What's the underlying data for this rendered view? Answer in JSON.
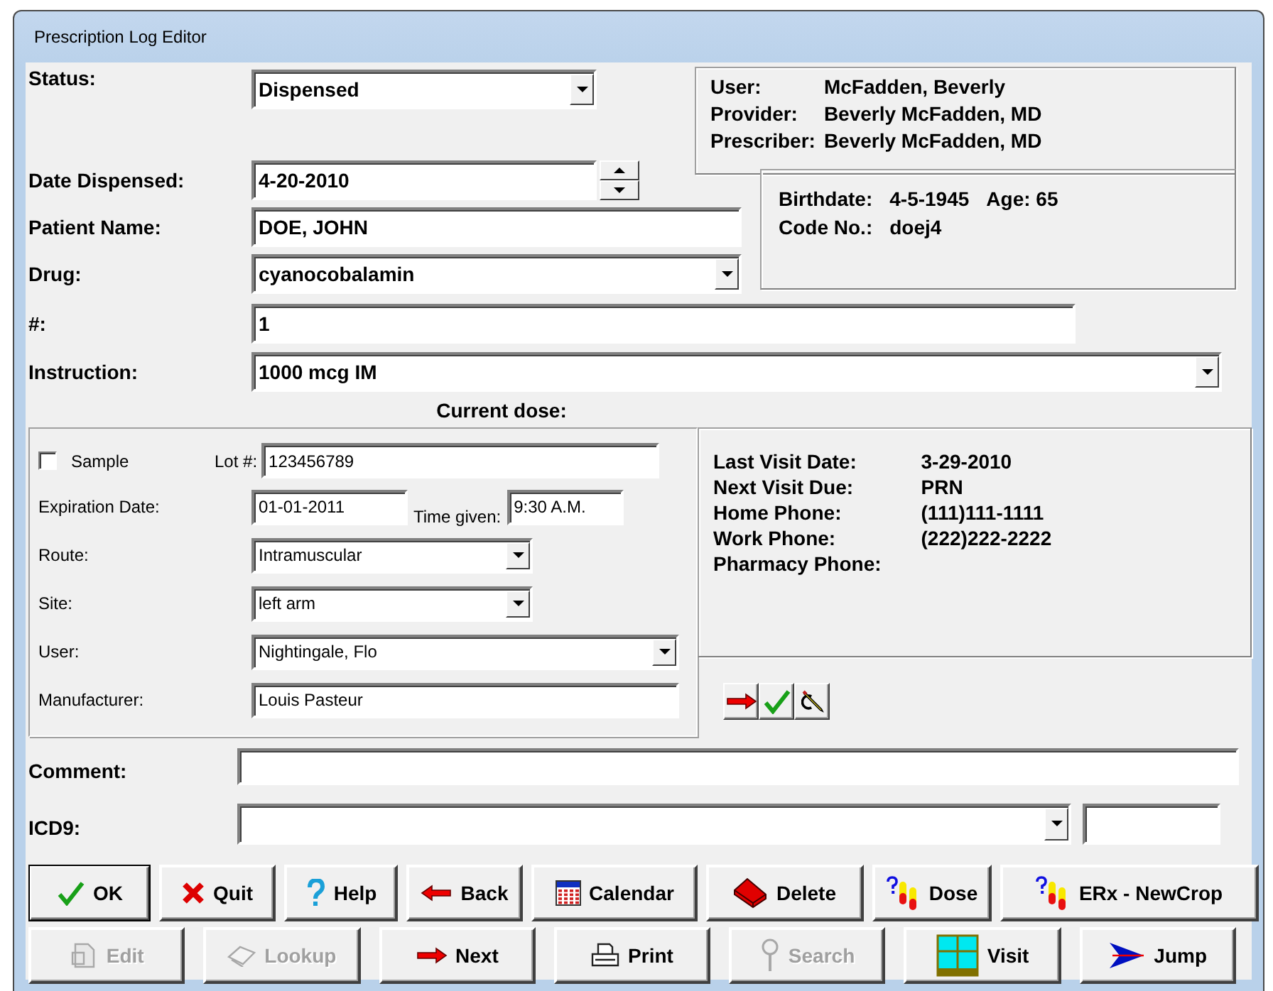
{
  "window": {
    "title": "Prescription Log Editor"
  },
  "status": {
    "label": "Status:",
    "value": "Dispensed"
  },
  "user_box": [
    {
      "label": "User:",
      "value": "McFadden, Beverly"
    },
    {
      "label": "Provider:",
      "value": "Beverly McFadden, MD"
    },
    {
      "label": "Prescriber:",
      "value": "Beverly McFadden, MD"
    }
  ],
  "date_dispensed": {
    "label": "Date Dispensed:",
    "value": "4-20-2010"
  },
  "patient_name": {
    "label": "Patient Name:",
    "value": "DOE, JOHN"
  },
  "patient_box": {
    "birthdate_label": "Birthdate:",
    "birthdate": "4-5-1945",
    "age": "Age: 65",
    "code_label": "Code No.:",
    "code": "doej4"
  },
  "drug": {
    "label": "Drug:",
    "value": "cyanocobalamin"
  },
  "quantity": {
    "label": "#:",
    "value": "1"
  },
  "instruction": {
    "label": "Instruction:",
    "value": "1000 mcg IM"
  },
  "current_dose": {
    "title": "Current dose:",
    "sample": {
      "label": "Sample",
      "checked": false
    },
    "lot": {
      "label": "Lot #:",
      "value": "123456789"
    },
    "expiration": {
      "label": "Expiration Date:",
      "value": "01-01-2011"
    },
    "time_given": {
      "label": "Time given:",
      "value": "9:30 A.M."
    },
    "route": {
      "label": "Route:",
      "value": "Intramuscular"
    },
    "site": {
      "label": "Site:",
      "value": "left arm"
    },
    "user": {
      "label": "User:",
      "value": "Nightingale, Flo"
    },
    "manufacturer": {
      "label": "Manufacturer:",
      "value": "Louis Pasteur"
    }
  },
  "visit_info": [
    {
      "label": "Last Visit Date:",
      "value": "3-29-2010"
    },
    {
      "label": "Next Visit Due:",
      "value": "PRN"
    },
    {
      "label": "Home Phone:",
      "value": "(111)111-1111"
    },
    {
      "label": "Work Phone:",
      "value": "(222)222-2222"
    },
    {
      "label": "Pharmacy Phone:"
    }
  ],
  "comment": {
    "label": "Comment:"
  },
  "icd9": {
    "label": "ICD9:"
  },
  "buttons_row1": [
    {
      "label": "OK",
      "kind": "check",
      "disabled": false,
      "default": true
    },
    {
      "label": "Quit",
      "kind": "x",
      "disabled": false,
      "default": false
    },
    {
      "label": "Help",
      "kind": "question",
      "disabled": false,
      "default": false
    },
    {
      "label": "Back",
      "kind": "back",
      "disabled": false,
      "default": false
    },
    {
      "label": "Calendar",
      "kind": "calendar",
      "disabled": false,
      "default": false
    },
    {
      "label": "Delete",
      "kind": "eraser",
      "disabled": false,
      "default": false
    },
    {
      "label": "Dose",
      "kind": "dose",
      "disabled": false,
      "default": false
    },
    {
      "label": "ERx - NewCrop",
      "kind": "dose",
      "disabled": false,
      "default": false
    }
  ],
  "buttons_row2": [
    {
      "label": "Edit",
      "kind": "edit",
      "disabled": true,
      "default": false
    },
    {
      "label": "Lookup",
      "kind": "lookup",
      "disabled": true,
      "default": false
    },
    {
      "label": "Next",
      "kind": "next",
      "disabled": false,
      "default": false
    },
    {
      "label": "Print",
      "kind": "print",
      "disabled": false,
      "default": false
    },
    {
      "label": "Search",
      "kind": "search",
      "disabled": true,
      "default": false
    },
    {
      "label": "Visit",
      "kind": "visit",
      "disabled": false,
      "default": false
    },
    {
      "label": "Jump",
      "kind": "jump",
      "disabled": false,
      "default": false
    }
  ]
}
